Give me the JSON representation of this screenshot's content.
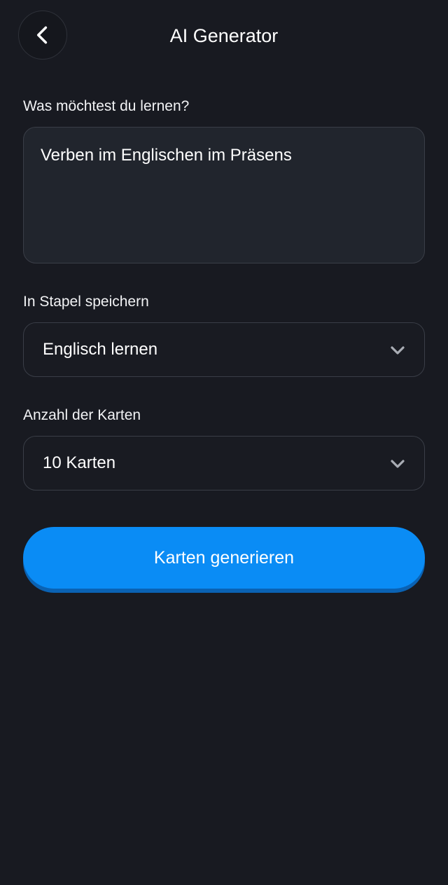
{
  "header": {
    "title": "AI Generator",
    "back_icon": "chevron-left-icon"
  },
  "form": {
    "topic": {
      "label": "Was möchtest du lernen?",
      "value": "Verben im Englischen im Präsens"
    },
    "deck": {
      "label": "In Stapel speichern",
      "value": "Englisch lernen",
      "icon": "chevron-down-icon"
    },
    "count": {
      "label": "Anzahl der Karten",
      "value": "10 Karten",
      "icon": "chevron-down-icon"
    },
    "generate_label": "Karten generieren"
  },
  "colors": {
    "background": "#181a21",
    "field": "#21252d",
    "border": "#3a3e47",
    "accent": "#0a8cf5",
    "accent_shadow": "#0a62b3"
  }
}
